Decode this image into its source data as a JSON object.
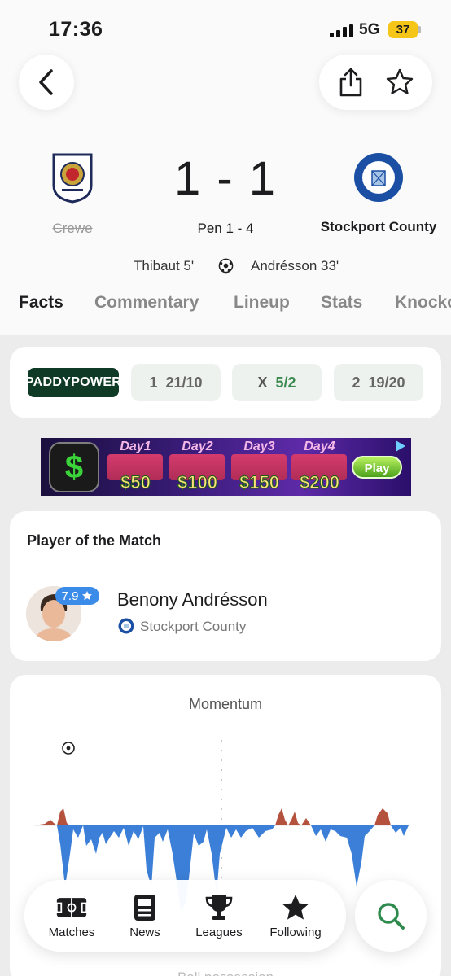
{
  "status_bar": {
    "time": "17:36",
    "network": "5G",
    "battery": "37"
  },
  "match": {
    "home_team": "Crewe",
    "away_team": "Stockport County",
    "score": "1 - 1",
    "penalties": "Pen  1 - 4",
    "home_scorer": "Thibaut 5'",
    "away_scorer": "Andrésson 33'"
  },
  "tabs": [
    "Facts",
    "Commentary",
    "Lineup",
    "Stats",
    "Knocko"
  ],
  "odds": {
    "bookmaker": "PADDYPOWER",
    "home": {
      "label": "1",
      "value": "21/10"
    },
    "draw": {
      "label": "X",
      "value": "5/2"
    },
    "away": {
      "label": "2",
      "value": "19/20"
    }
  },
  "ad": {
    "days": [
      {
        "label": "Day1",
        "amount": "$50"
      },
      {
        "label": "Day2",
        "amount": "$100"
      },
      {
        "label": "Day3",
        "amount": "$150"
      },
      {
        "label": "Day4",
        "amount": "$200"
      }
    ],
    "cta": "Play"
  },
  "player_of_match": {
    "title": "Player of the Match",
    "name": "Benony Andrésson",
    "team": "Stockport County",
    "rating": "7.9"
  },
  "momentum": {
    "title": "Momentum"
  },
  "ball_possession": "Ball possession",
  "nav": {
    "items": [
      {
        "label": "Matches",
        "icon": "pitch-icon"
      },
      {
        "label": "News",
        "icon": "news-icon"
      },
      {
        "label": "Leagues",
        "icon": "trophy-icon"
      },
      {
        "label": "Following",
        "icon": "star-icon"
      }
    ]
  },
  "colors": {
    "accent_green": "#3a8a4f",
    "home_momentum": "#b5523e",
    "away_momentum": "#3b7fd8",
    "rating_blue": "#3b8be8"
  }
}
